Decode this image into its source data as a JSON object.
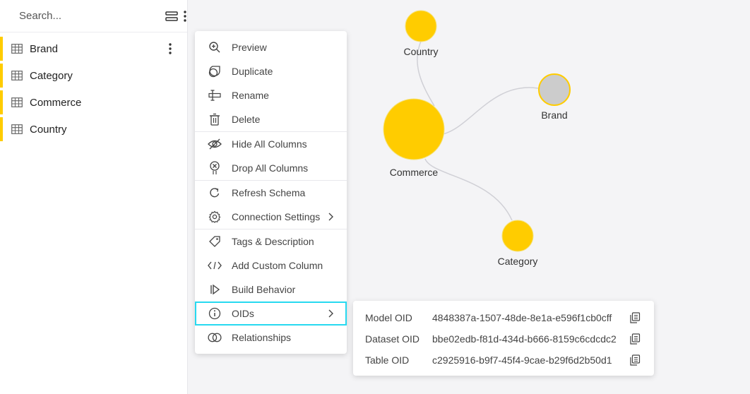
{
  "sidebar": {
    "search_placeholder": "Search...",
    "tables": [
      {
        "label": "Brand",
        "has_menu": true
      },
      {
        "label": "Category"
      },
      {
        "label": "Commerce"
      },
      {
        "label": "Country"
      }
    ]
  },
  "graph": {
    "nodes": [
      {
        "label": "Country",
        "color": "#ffcc00"
      },
      {
        "label": "Brand",
        "color": "#cccccc"
      },
      {
        "label": "Commerce",
        "color": "#ffcc00"
      },
      {
        "label": "Category",
        "color": "#ffcc00"
      }
    ]
  },
  "context_menu": {
    "groups": [
      [
        {
          "label": "Preview",
          "icon": "zoom-in-icon"
        },
        {
          "label": "Duplicate",
          "icon": "duplicate-icon"
        },
        {
          "label": "Rename",
          "icon": "rename-icon"
        },
        {
          "label": "Delete",
          "icon": "trash-icon"
        }
      ],
      [
        {
          "label": "Hide All Columns",
          "icon": "eye-off-icon"
        },
        {
          "label": "Drop All Columns",
          "icon": "drop-icon"
        }
      ],
      [
        {
          "label": "Refresh Schema",
          "icon": "refresh-icon"
        },
        {
          "label": "Connection Settings",
          "icon": "gear-icon",
          "submenu": true
        }
      ],
      [
        {
          "label": "Tags & Description",
          "icon": "tag-icon"
        },
        {
          "label": "Add Custom Column",
          "icon": "code-icon"
        },
        {
          "label": "Build Behavior",
          "icon": "behavior-icon"
        },
        {
          "label": "OIDs",
          "icon": "info-icon",
          "submenu": true,
          "highlight": true
        },
        {
          "label": "Relationships",
          "icon": "relationships-icon"
        }
      ]
    ]
  },
  "oids": [
    {
      "label": "Model OID",
      "value": "4848387a-1507-48de-8e1a-e596f1cb0cff"
    },
    {
      "label": "Dataset OID",
      "value": "bbe02edb-f81d-434d-b666-8159c6cdcdc2"
    },
    {
      "label": "Table OID",
      "value": "c2925916-b9f7-45f4-9cae-b29f6d2b50d1"
    }
  ],
  "colors": {
    "accent": "#ffcc00",
    "highlight_outline": "#27d9f0"
  }
}
